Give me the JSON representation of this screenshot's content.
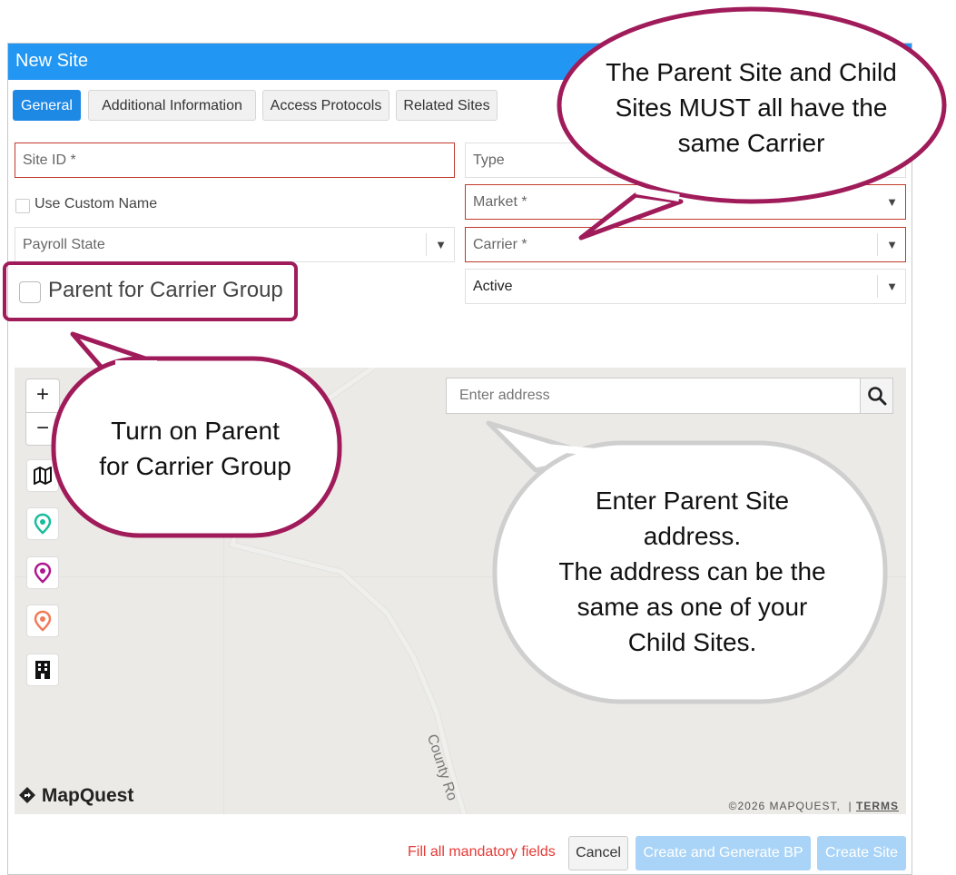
{
  "dialog": {
    "title": "New Site",
    "tabs": [
      "General",
      "Additional Information",
      "Access Protocols",
      "Related Sites"
    ],
    "active_tab": "General"
  },
  "form": {
    "site_id_placeholder": "Site ID *",
    "use_custom_name_label": "Use Custom Name",
    "payroll_state_placeholder": "Payroll State",
    "parent_group_label": "Parent for Carrier Group",
    "type_placeholder": "Type",
    "market_placeholder": "Market *",
    "carrier_placeholder": "Carrier *",
    "status_value": "Active"
  },
  "map": {
    "zoom_in": "+",
    "zoom_out": "−",
    "address_placeholder": "Enter address",
    "logo": "MapQuest",
    "copyright": "©2026 MAPQUEST,",
    "terms": "TERMS",
    "road_label": "County Ro",
    "pin_colors": [
      "#1abc9c",
      "#b0188f",
      "#f07b5a"
    ]
  },
  "footer": {
    "message": "Fill all mandatory fields",
    "cancel": "Cancel",
    "create_bp": "Create and Generate BP",
    "create_site": "Create Site"
  },
  "callouts": {
    "carrier": [
      "The Parent Site and Child",
      "Sites MUST all have the",
      "same Carrier"
    ],
    "parent": [
      "Turn on Parent",
      "for Carrier Group"
    ],
    "address": [
      "Enter Parent Site",
      "address.",
      "The address can be the",
      "same as one of your",
      "Child Sites."
    ]
  },
  "colors": {
    "header": "#2196f3",
    "callout_border": "#a01b5a",
    "required_border": "#c0392b"
  }
}
